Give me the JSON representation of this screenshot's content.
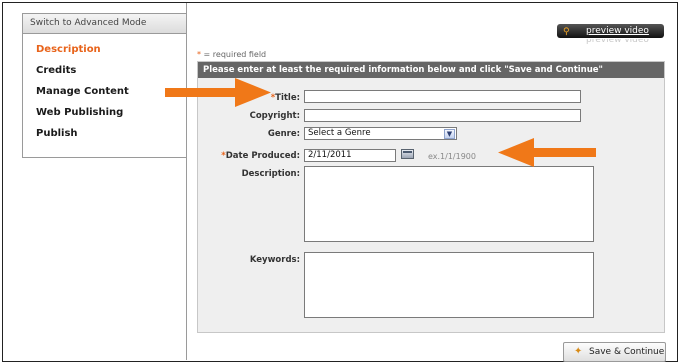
{
  "sidebar": {
    "mode_toggle": "Switch to Advanced Mode",
    "items": [
      {
        "label": "Description"
      },
      {
        "label": "Credits"
      },
      {
        "label": "Manage Content"
      },
      {
        "label": "Web Publishing"
      },
      {
        "label": "Publish"
      }
    ]
  },
  "preview": {
    "label": "preview video",
    "icon": "magnifier-icon"
  },
  "form": {
    "required_star": "*",
    "required_note": "= required field",
    "header": "Please enter at least the required information below and click \"Save and Continue\"",
    "fields": {
      "title": {
        "label": "Title:",
        "value": ""
      },
      "copyright": {
        "label": "Copyright:",
        "value": ""
      },
      "genre": {
        "label": "Genre:",
        "selected": "Select a Genre"
      },
      "date_produced": {
        "label": "Date Produced:",
        "value": "2/11/2011",
        "example": "ex.1/1/1900"
      },
      "description": {
        "label": "Description:",
        "value": ""
      },
      "keywords": {
        "label": "Keywords:",
        "value": ""
      }
    }
  },
  "actions": {
    "save_label": "Save & Continue"
  },
  "colors": {
    "accent": "#e8631a",
    "header_bg": "#666666",
    "panel_bg": "#efefef"
  }
}
